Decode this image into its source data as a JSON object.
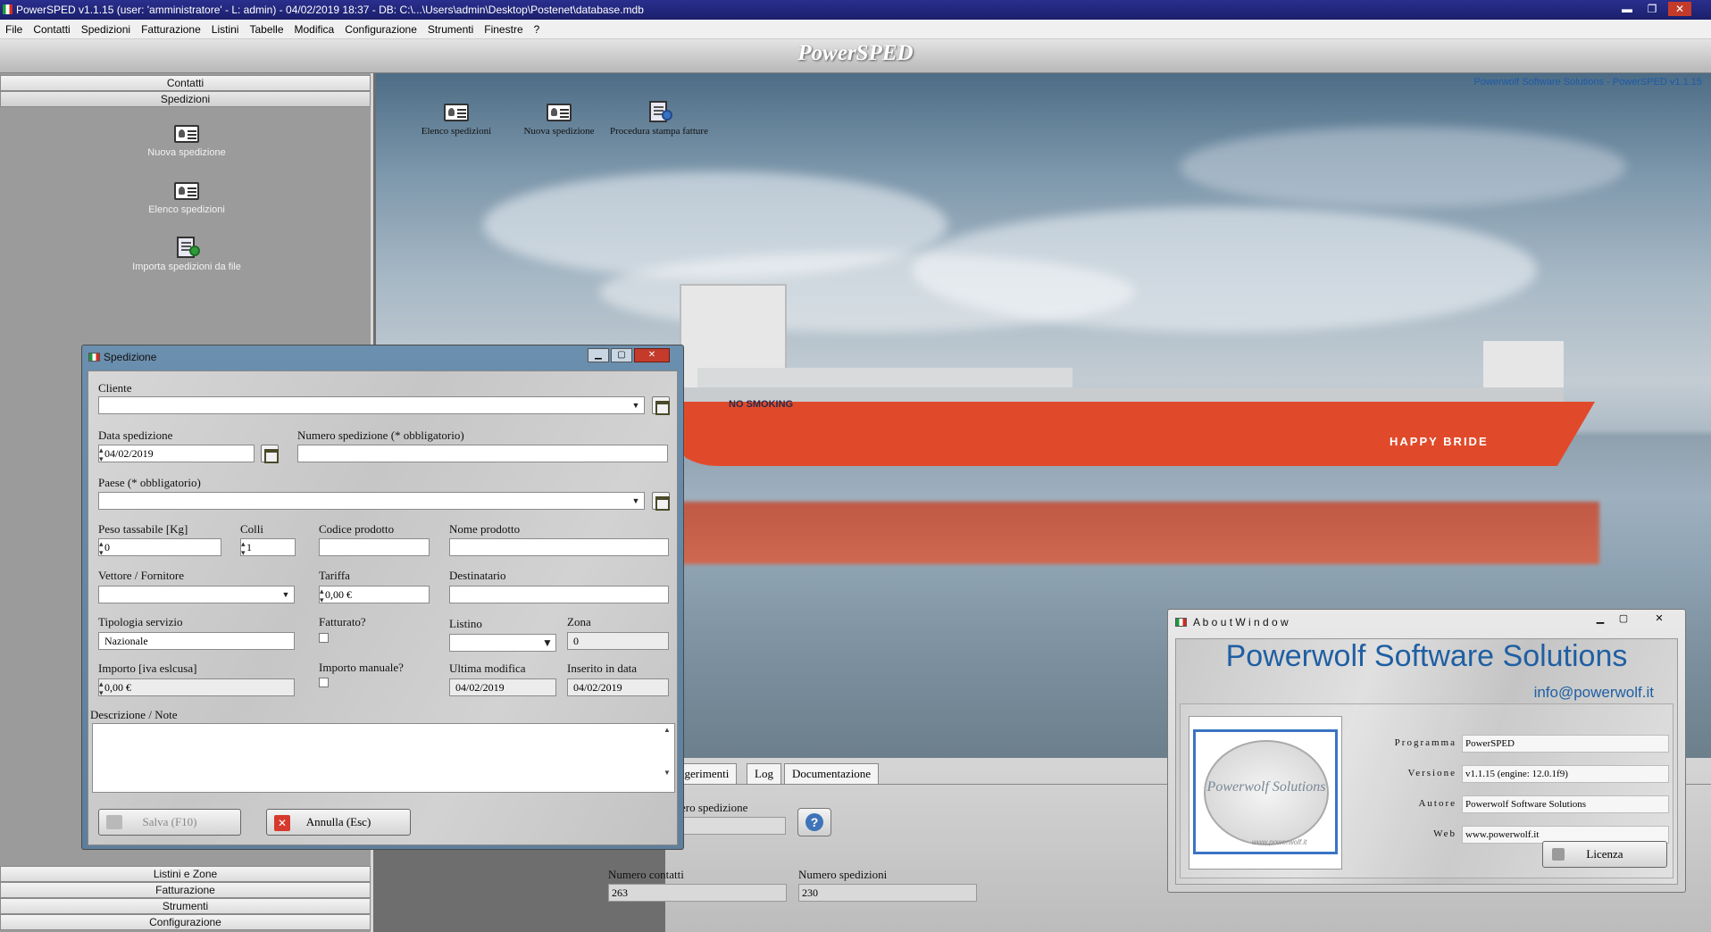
{
  "window": {
    "title": "PowerSPED v1.1.15  (user: 'amministratore'  - L: admin) - 04/02/2019 18:37 - DB: C:\\...\\Users\\admin\\Desktop\\Postenet\\database.mdb",
    "minimize": "▬",
    "restore": "❐",
    "close": "✕"
  },
  "menu": [
    "File",
    "Contatti",
    "Spedizioni",
    "Fatturazione",
    "Listini",
    "Tabelle",
    "Modifica",
    "Configurazione",
    "Strumenti",
    "Finestre",
    "?"
  ],
  "banner": {
    "title": "PowerSPED"
  },
  "sidebar": {
    "headers_top": [
      "Contatti",
      "Spedizioni"
    ],
    "items": [
      {
        "label": "Nuova spedizione",
        "icon": "card-icon"
      },
      {
        "label": "Elenco spedizioni",
        "icon": "card-list-icon"
      },
      {
        "label": "Importa spedizioni da file",
        "icon": "import-file-icon"
      }
    ],
    "headers_bottom": [
      "Listini e Zone",
      "Fatturazione",
      "Strumenti",
      "Configurazione"
    ]
  },
  "main": {
    "credit": "Powerwolf Software Solutions - PowerSPED v1.1.15",
    "ship_name": "HAPPY BRIDE",
    "ship_sign": "NO SMOKING",
    "icons": [
      {
        "label": "Elenco spedizioni",
        "icon": "card-list-icon"
      },
      {
        "label": "Nuova spedizione",
        "icon": "card-icon"
      },
      {
        "label": "Procedura stampa fatture",
        "icon": "print-invoices-icon"
      }
    ]
  },
  "bottom_panel": {
    "tabs": [
      "ggerimenti",
      "Log",
      "Documentazione"
    ],
    "search_label": "ero spedizione",
    "search_value": "",
    "contacts_label": "Numero contatti",
    "contacts_value": "263",
    "shipments_label": "Numero spedizioni",
    "shipments_value": "230"
  },
  "dialog": {
    "title": "Spedizione",
    "cliente_label": "Cliente",
    "cliente_value": "",
    "data_label": "Data spedizione",
    "data_value": "04/02/2019",
    "numero_label": "Numero spedizione (* obbligatorio)",
    "numero_value": "",
    "paese_label": "Paese (* obbligatorio)",
    "paese_value": "",
    "peso_label": "Peso tassabile [Kg]",
    "peso_value": "0",
    "colli_label": "Colli",
    "colli_value": "1",
    "codice_label": "Codice prodotto",
    "codice_value": "",
    "nome_label": "Nome prodotto",
    "nome_value": "",
    "vettore_label": "Vettore / Fornitore",
    "vettore_value": "",
    "tariffa_label": "Tariffa",
    "tariffa_value": "0,00 €",
    "destinatario_label": "Destinatario",
    "destinatario_value": "",
    "tipologia_label": "Tipologia servizio",
    "tipologia_value": "Nazionale",
    "fatturato_label": "Fatturato?",
    "listino_label": "Listino",
    "listino_value": "",
    "zona_label": "Zona",
    "zona_value": "0",
    "importo_label": "Importo [iva eslcusa]",
    "importo_value": "0,00 €",
    "manuale_label": "Importo manuale?",
    "ultima_label": "Ultima modifica",
    "ultima_value": "04/02/2019",
    "inserito_label": "Inserito in data",
    "inserito_value": "04/02/2019",
    "note_label": "Descrizione / Note",
    "note_value": "",
    "save_label": "Salva (F10)",
    "cancel_label": "Annulla (Esc)"
  },
  "about": {
    "title": "A b o u t   W i n d o w",
    "company": "Powerwolf Software Solutions",
    "email": "info@powerwolf.it",
    "logo_text": "Powerwolf Solutions",
    "logo_url": "www.powerwolf.it",
    "fields": [
      {
        "label": "Programma",
        "value": "PowerSPED"
      },
      {
        "label": "Versione",
        "value": "v1.1.15  (engine: 12.0.1f9)"
      },
      {
        "label": "Autore",
        "value": "Powerwolf Software Solutions"
      },
      {
        "label": "Web",
        "value": "www.powerwolf.it"
      }
    ],
    "license_label": "Licenza"
  }
}
